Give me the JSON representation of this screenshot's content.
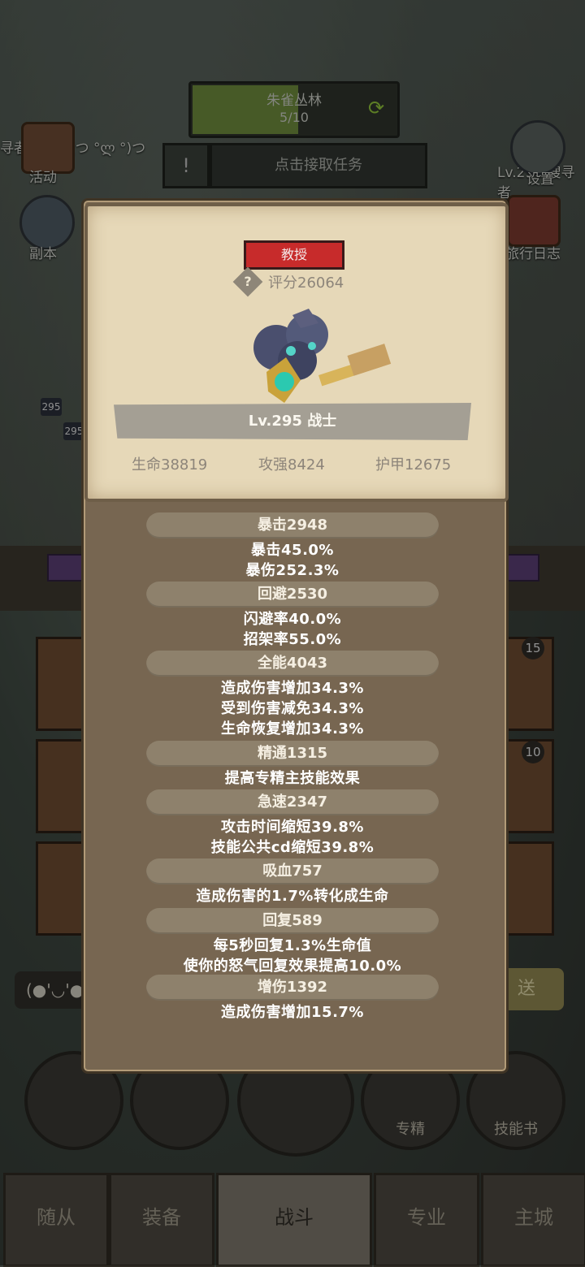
{
  "background": {
    "zone": {
      "name": "朱雀丛林",
      "progress": "5/10"
    },
    "quest": {
      "label": "点击接取任务"
    },
    "left_menu": [
      "活动",
      "副本"
    ],
    "right_menu": [
      "设置",
      "旅行日志"
    ],
    "player_name_left": "寻者法师",
    "emote_left": "(つ °ლ °)つ",
    "player_lv_right": "Lv.290 搜寻者",
    "party": [
      "295",
      "295"
    ],
    "card_badges": [
      "15",
      "10"
    ],
    "emoji_input": "(●'◡'●",
    "send_label": "送",
    "action_buttons": [
      "",
      "",
      "",
      "专精",
      "技能书"
    ],
    "bottom_nav": [
      "随从",
      "装备",
      "战斗",
      "专业",
      "主城"
    ]
  },
  "modal": {
    "rank": "教授",
    "score": "评分26064",
    "level_class": "Lv.295 战士",
    "core_stats": [
      "生命38819",
      "攻强8424",
      "护甲12675"
    ],
    "sections": [
      {
        "title": "暴击2948",
        "lines": [
          "暴击45.0%",
          "暴伤252.3%"
        ]
      },
      {
        "title": "回避2530",
        "lines": [
          "闪避率40.0%",
          "招架率55.0%"
        ]
      },
      {
        "title": "全能4043",
        "lines": [
          "造成伤害增加34.3%",
          "受到伤害减免34.3%",
          "生命恢复增加34.3%"
        ]
      },
      {
        "title": "精通1315",
        "lines": [
          "提高专精主技能效果"
        ]
      },
      {
        "title": "急速2347",
        "lines": [
          "攻击时间缩短39.8%",
          "技能公共cd缩短39.8%"
        ]
      },
      {
        "title": "吸血757",
        "lines": [
          "造成伤害的1.7%转化成生命"
        ]
      },
      {
        "title": "回复589",
        "lines": [
          "每5秒回复1.3%生命值",
          "使你的怒气回复效果提高10.0%"
        ]
      },
      {
        "title": "增伤1392",
        "lines": [
          "造成伤害增加15.7%"
        ]
      }
    ]
  },
  "colors": {
    "rank_red": "#c72b2b",
    "parchment": "#e6d8b8",
    "modal_brown": "#776651",
    "zone_green": "#6d8a3c"
  }
}
